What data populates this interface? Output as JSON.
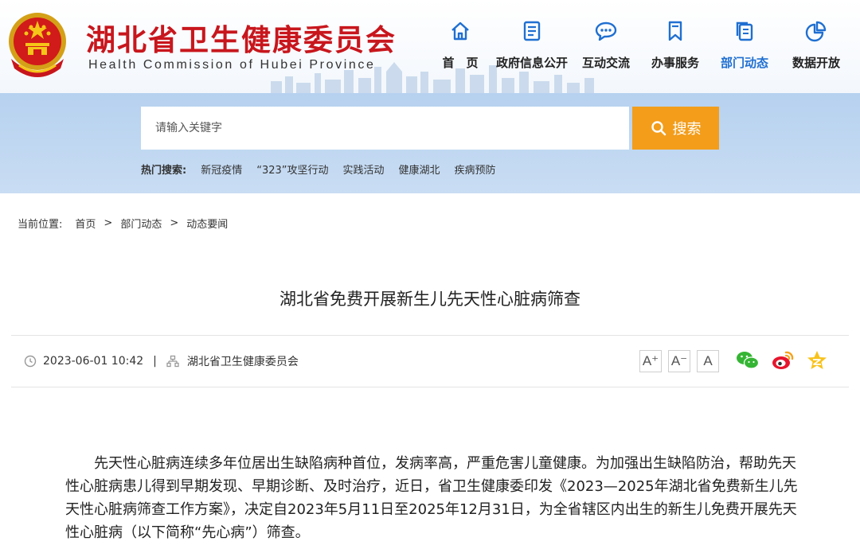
{
  "site": {
    "title": "湖北省卫生健康委员会",
    "subtitle": "Health Commission of Hubei Province"
  },
  "nav": [
    {
      "label": "首　页",
      "icon": "home-icon"
    },
    {
      "label": "政府信息公开",
      "icon": "document-list-icon"
    },
    {
      "label": "互动交流",
      "icon": "chat-bubble-icon"
    },
    {
      "label": "办事服务",
      "icon": "bookmark-icon"
    },
    {
      "label": "部门动态",
      "icon": "news-copy-icon",
      "active": true
    },
    {
      "label": "数据开放",
      "icon": "pie-chart-icon"
    }
  ],
  "search": {
    "placeholder": "请输入关键字",
    "button_label": "搜索",
    "hot_label": "热门搜索:",
    "hot_terms": [
      "新冠疫情",
      "“323”攻坚行动",
      "实践活动",
      "健康湖北",
      "疾病预防"
    ]
  },
  "breadcrumb": {
    "label": "当前位置:",
    "items": [
      "首页",
      "部门动态",
      "动态要闻"
    ],
    "separator": ">"
  },
  "article": {
    "title": "湖北省免费开展新生儿先天性心脏病筛查",
    "date": "2023-06-01 10:42",
    "divider": "|",
    "source": "湖北省卫生健康委员会",
    "font_sizes": [
      "A⁺",
      "A⁻",
      "A"
    ],
    "share": [
      "wechat-icon",
      "weibo-icon",
      "qzone-icon"
    ],
    "body": "先天性心脏病连续多年位居出生缺陷病种首位，发病率高，严重危害儿童健康。为加强出生缺陷防治，帮助先天性心脏病患儿得到早期发现、早期诊断、及时治疗，近日，省卫生健康委印发《2023—2025年湖北省免费新生儿先天性心脏病筛查工作方案》，决定自2023年5月11日至2025年12月31日，为全省辖区内出生的新生儿免费开展先天性心脏病（以下简称“先心病”）筛查。"
  },
  "colors": {
    "brand_red": "#c8161d",
    "nav_blue": "#1f6fd1",
    "search_orange": "#f39d1b",
    "band_blue": "#b6d1ef"
  }
}
